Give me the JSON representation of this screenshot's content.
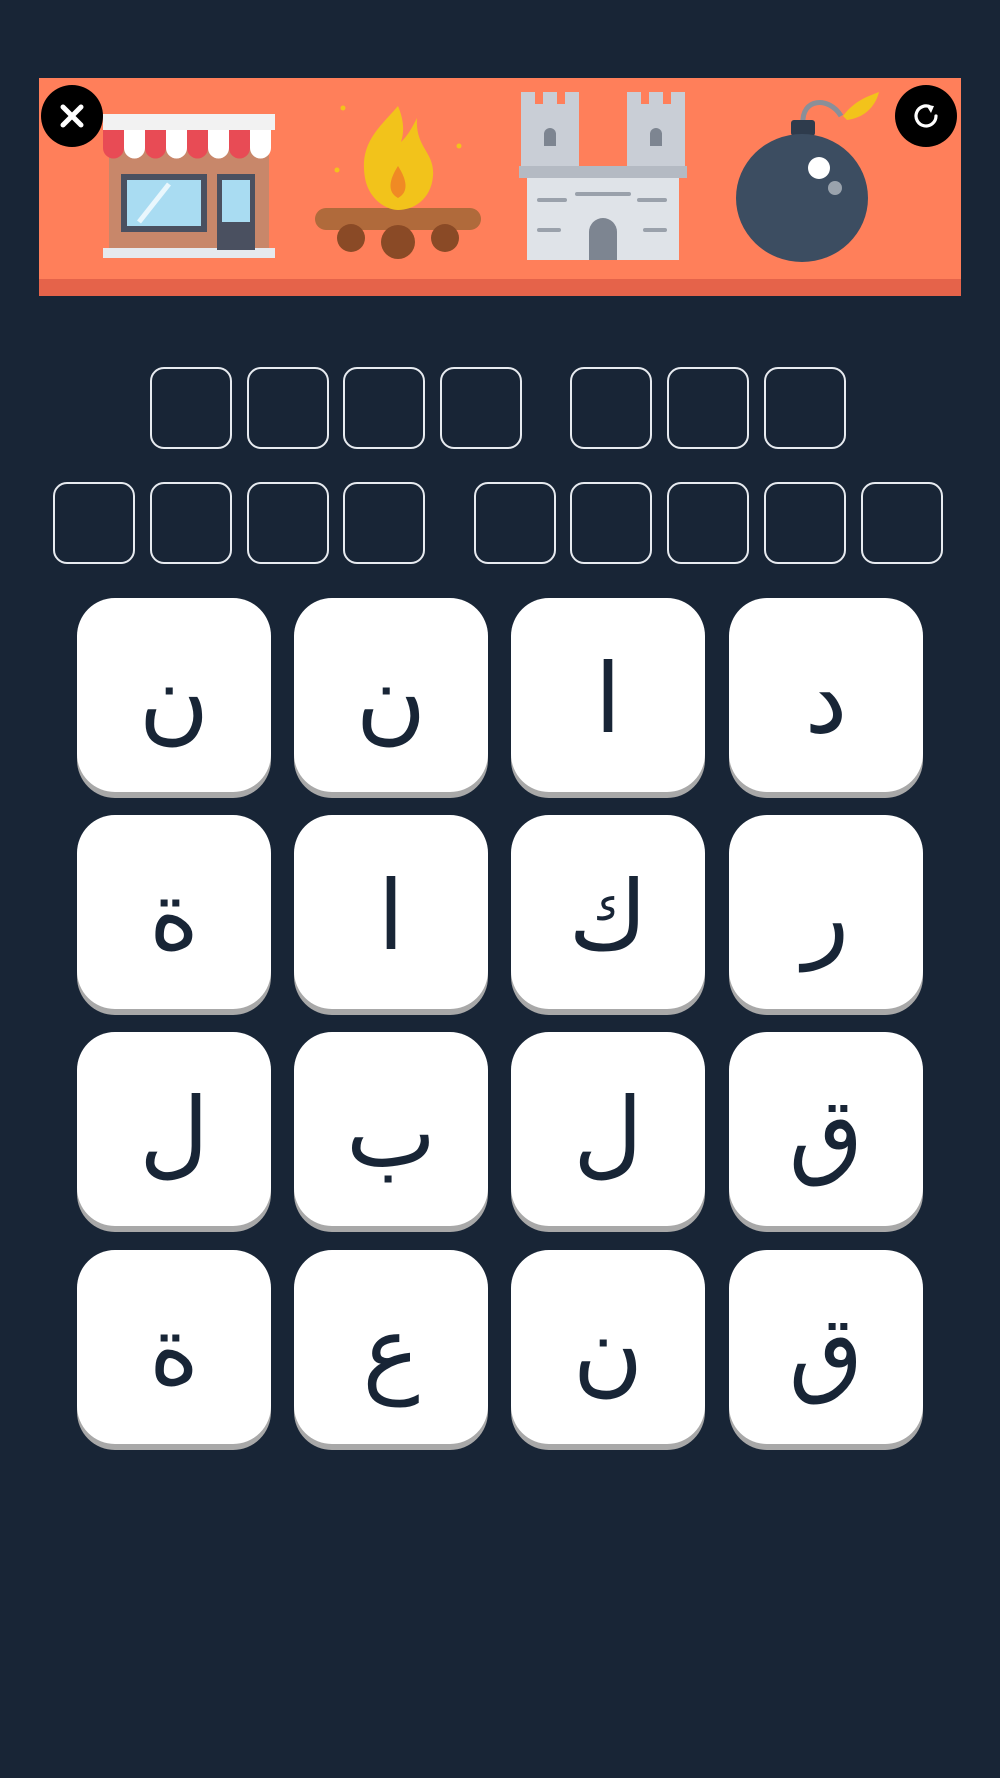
{
  "colors": {
    "background": "#182536",
    "banner": "#ff7f5a",
    "banner_strip": "#e5634a",
    "tile": "#ffffff",
    "tile_text": "#182536",
    "slot_border": "#e7ebf0"
  },
  "controls": {
    "close_icon": "close-icon",
    "refresh_icon": "refresh-icon"
  },
  "clue_pictures": [
    "shop-icon",
    "campfire-icon",
    "castle-icon",
    "bomb-icon"
  ],
  "answer": {
    "rows": [
      {
        "words": [
          4,
          3
        ]
      },
      {
        "words": [
          4,
          5
        ]
      }
    ]
  },
  "letters": {
    "rows": [
      [
        "ن",
        "ن",
        "ا",
        "د"
      ],
      [
        "ة",
        "ا",
        "ك",
        "ر"
      ],
      [
        "ل",
        "ب",
        "ل",
        "ق"
      ],
      [
        "ة",
        "ع",
        "ن",
        "ق"
      ]
    ]
  }
}
